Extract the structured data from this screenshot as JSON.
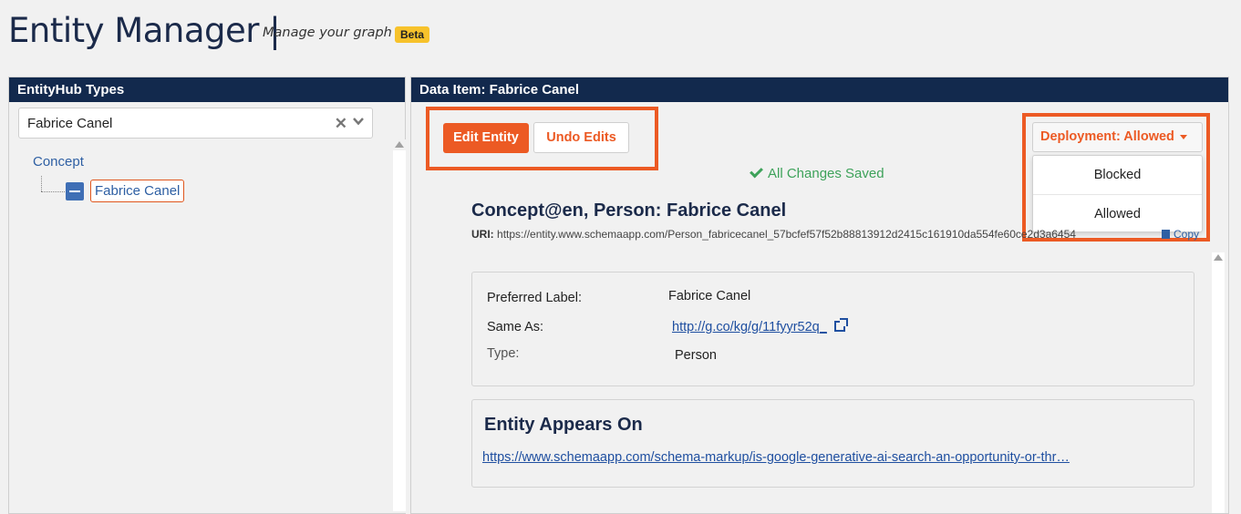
{
  "header": {
    "title": "Entity Manager |",
    "subtitle": "Manage your graph",
    "badge": "Beta"
  },
  "left_panel": {
    "heading": "EntityHub Types",
    "search": {
      "value": "Fabrice Canel",
      "clear_icon": "close-icon",
      "toggle_icon": "chevron-down-icon"
    },
    "tree": {
      "root": "Concept",
      "child": "Fabrice Canel"
    }
  },
  "right_panel": {
    "heading": "Data Item: Fabrice Canel",
    "buttons": {
      "edit": "Edit Entity",
      "undo": "Undo Edits"
    },
    "deployment": {
      "label": "Deployment: Allowed",
      "options": [
        "Blocked",
        "Allowed"
      ]
    },
    "status": "All Changes Saved",
    "entity": {
      "title": "Concept@en, Person:  Fabrice Canel",
      "uri_label": "URI:",
      "uri": "https://entity.www.schemaapp.com/Person_fabricecanel_57bcfef57f52b88813912d2415c161910da554fe60ce2d3a6454",
      "copy": "Copy"
    },
    "properties": [
      {
        "label": "Preferred Label:",
        "value": "Fabrice Canel"
      },
      {
        "label": "Same As:",
        "value": "http://g.co/kg/g/11fyyr52q_"
      },
      {
        "label": "Type:",
        "value": "Person"
      }
    ],
    "appears_on": {
      "title": "Entity Appears On",
      "link": "https://www.schemaapp.com/schema-markup/is-google-generative-ai-search-an-opportunity-or-thr…"
    }
  },
  "colors": {
    "accent": "#ec5a24",
    "header_bar": "#12294d",
    "success": "#3da25a",
    "link": "#1f4fa0",
    "beta": "#f7c22b"
  }
}
